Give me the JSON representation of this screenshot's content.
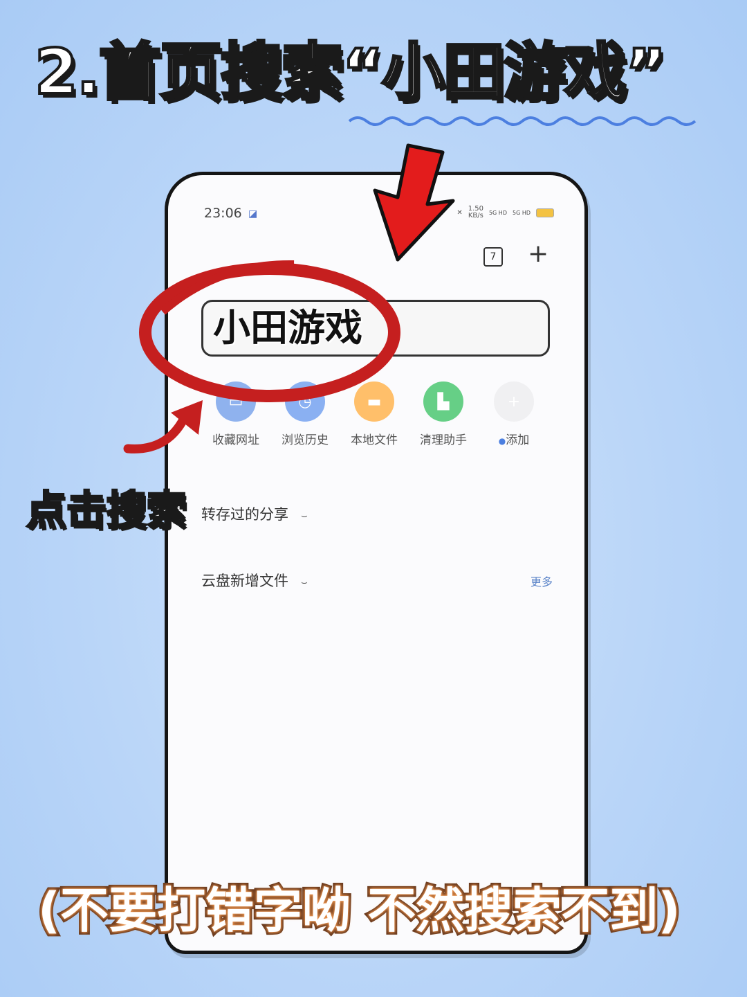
{
  "headline": "2.首页搜索“小田游戏”",
  "side_label": "点击搜索",
  "footer_note": "(不要打错字呦 不然搜索不到)",
  "phone": {
    "status": {
      "time": "23:06",
      "net_speed": "1.50",
      "net_unit": "KB/s",
      "signal1": "5G HD",
      "signal2": "5G HD"
    },
    "toolbar": {
      "tab_count": "7",
      "add_label": "+"
    },
    "search": {
      "value": "小田游戏"
    },
    "quick_actions": [
      {
        "label": "收藏网址",
        "icon": "bookmark-icon"
      },
      {
        "label": "浏览历史",
        "icon": "history-icon"
      },
      {
        "label": "本地文件",
        "icon": "folder-icon"
      },
      {
        "label": "清理助手",
        "icon": "broom-icon"
      },
      {
        "label": "添加",
        "icon": "plus-icon"
      }
    ],
    "sections": [
      {
        "title": "转存过的分享"
      },
      {
        "title": "云盘新增文件",
        "more": "更多"
      }
    ]
  },
  "colors": {
    "accent_red": "#e31c1c",
    "circle_red": "#c51f1f",
    "link_blue": "#5a83c8"
  }
}
